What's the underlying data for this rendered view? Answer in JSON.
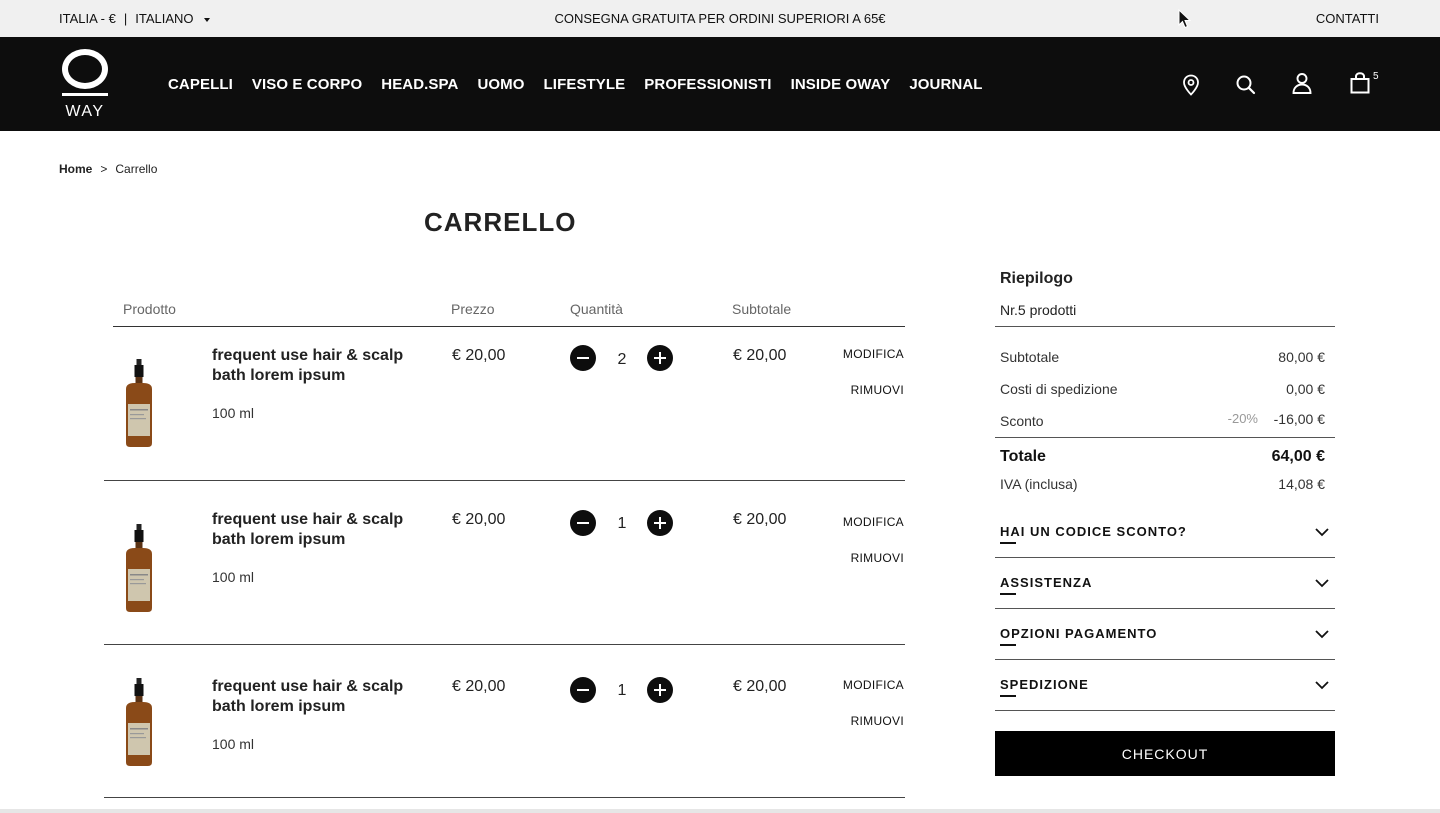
{
  "topbar": {
    "country": "ITALIA - €",
    "language": "ITALIANO",
    "promo": "CONSEGNA GRATUITA PER ORDINI SUPERIORI A 65€",
    "contacts": "CONTATTI"
  },
  "header": {
    "logo_text": "WAY",
    "nav": [
      "CAPELLI",
      "VISO E CORPO",
      "HEAD.SPA",
      "UOMO",
      "LIFESTYLE",
      "PROFESSIONISTI",
      "INSIDE OWAY",
      "JOURNAL"
    ],
    "icons": [
      "location-pin-icon",
      "search-icon",
      "user-icon",
      "shopping-bag-icon"
    ],
    "cart_count": "5"
  },
  "breadcrumb": {
    "home": "Home",
    "separator": ">",
    "current": "Carrello"
  },
  "page_title": "CARRELLO",
  "table": {
    "headers": [
      "Prodotto",
      "Prezzo",
      "Quantità",
      "Subtotale"
    ],
    "rows": [
      {
        "name": "frequent use hair & scalp bath lorem ipsum",
        "size": "100 ml",
        "price": "€ 20,00",
        "qty": "2",
        "subtotal": "€ 20,00",
        "edit": "MODIFICA",
        "remove": "RIMUOVI"
      },
      {
        "name": "frequent use hair & scalp bath lorem ipsum",
        "size": "100 ml",
        "price": "€ 20,00",
        "qty": "1",
        "subtotal": "€ 20,00",
        "edit": "MODIFICA",
        "remove": "RIMUOVI"
      },
      {
        "name": "frequent use hair & scalp bath lorem ipsum",
        "size": "100 ml",
        "price": "€ 20,00",
        "qty": "1",
        "subtotal": "€ 20,00",
        "edit": "MODIFICA",
        "remove": "RIMUOVI"
      }
    ]
  },
  "summary": {
    "title": "Riepilogo",
    "count": "Nr.5 prodotti",
    "subtotal_label": "Subtotale",
    "subtotal_value": "80,00 €",
    "shipping_label": "Costi di spedizione",
    "shipping_value": "0,00 €",
    "discount_label": "Sconto",
    "discount_percent": "-20%",
    "discount_value": "-16,00 €",
    "total_label": "Totale",
    "total_value": "64,00 €",
    "vat_label": "IVA (inclusa)",
    "vat_value": "14,08 €",
    "accordions": [
      "HAI UN CODICE SCONTO?",
      "ASSISTENZA",
      "OPZIONI PAGAMENTO",
      "SPEDIZIONE"
    ],
    "checkout": "CHECKOUT"
  },
  "colors": {
    "header_bg": "#0d0d0d",
    "topbar_bg": "#f0f0f0",
    "accent": "#000000"
  }
}
